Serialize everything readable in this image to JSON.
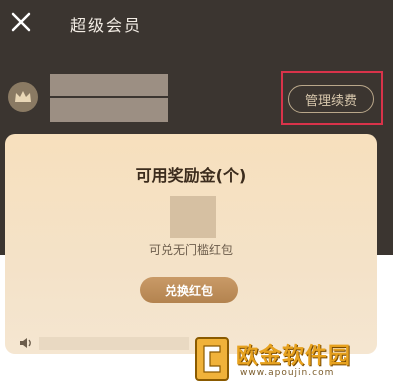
{
  "header": {
    "title": "超级会员",
    "close_icon": "close-icon",
    "manage_button": "管理续费",
    "highlight_color": "#d9334a"
  },
  "card": {
    "title": "可用奖励金(个)",
    "subtitle": "可兑无门槛红包",
    "redeem_button": "兑换红包",
    "notice_icon": "speaker-icon"
  },
  "watermark": {
    "text": "欧金软件园",
    "url": "www.apoujin.com"
  },
  "colors": {
    "header_bg": "#3b3530",
    "card_bg": "#f7e0bd",
    "button_bg": "#c99a67",
    "accent": "#e7a21f"
  }
}
